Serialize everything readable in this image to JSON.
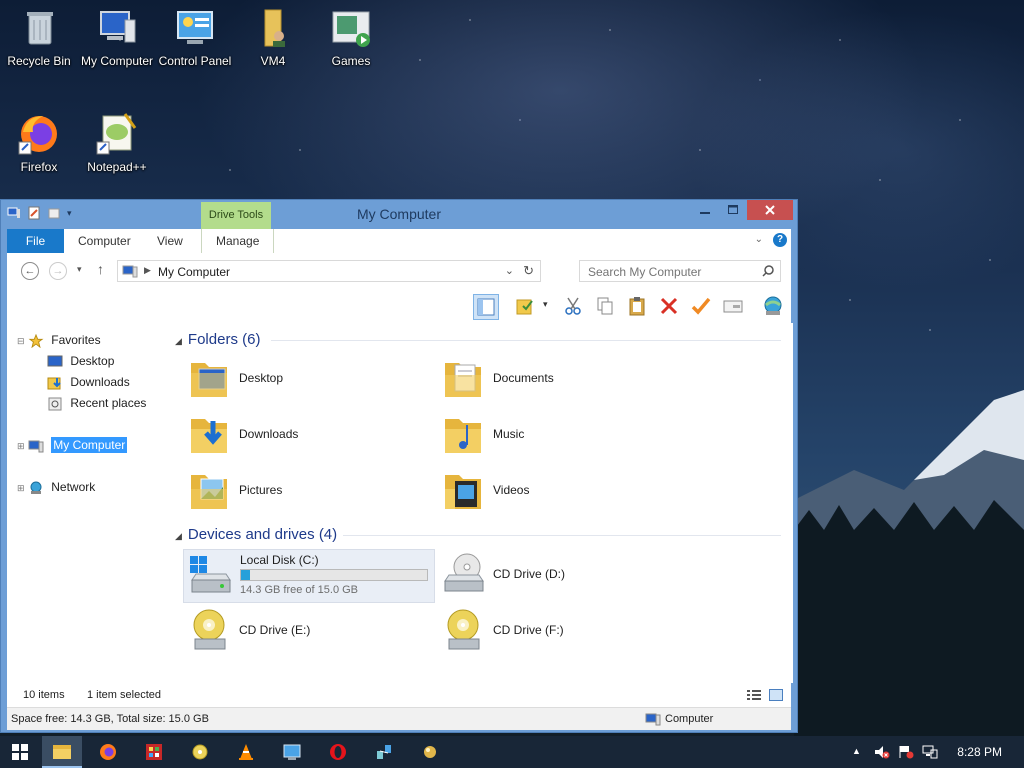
{
  "desktop": {
    "icons": [
      {
        "label": "Recycle Bin",
        "icon": "recycle-bin-icon"
      },
      {
        "label": "My Computer",
        "icon": "computer-icon"
      },
      {
        "label": "Control Panel",
        "icon": "control-panel-icon"
      },
      {
        "label": "VM4",
        "icon": "user-folder-icon"
      },
      {
        "label": "Games",
        "icon": "games-icon"
      },
      {
        "label": "Firefox",
        "icon": "firefox-icon"
      },
      {
        "label": "Notepad++",
        "icon": "notepadpp-icon"
      }
    ]
  },
  "window": {
    "title": "My Computer",
    "contextual_tab": "Drive Tools",
    "tabs": [
      "File",
      "Computer",
      "View",
      "Manage"
    ],
    "address": "My Computer",
    "search_placeholder": "Search My Computer",
    "nav": {
      "favorites": "Favorites",
      "desktop": "Desktop",
      "downloads": "Downloads",
      "recent": "Recent places",
      "computer": "My Computer",
      "network": "Network"
    },
    "folders_header": "Folders (6)",
    "folders": [
      "Desktop",
      "Documents",
      "Downloads",
      "Music",
      "Pictures",
      "Videos"
    ],
    "devices_header": "Devices and drives (4)",
    "drives": {
      "c_name": "Local Disk (C:)",
      "c_free": "14.3 GB free of 15.0 GB",
      "c_used_fraction": 0.047,
      "d": "CD Drive (D:)",
      "e": "CD Drive (E:)",
      "f": "CD Drive (F:)"
    },
    "status": {
      "items": "10 items",
      "selected": "1 item selected",
      "space": "Space free: 14.3 GB, Total size: 15.0 GB",
      "location": "Computer"
    }
  },
  "taskbar": {
    "clock": "8:28 PM"
  },
  "colors": {
    "accent": "#1979ca",
    "drive_tools": "#b3dc8c",
    "close": "#c75050",
    "taskbar": "#182637",
    "progress": "#26a0da"
  }
}
